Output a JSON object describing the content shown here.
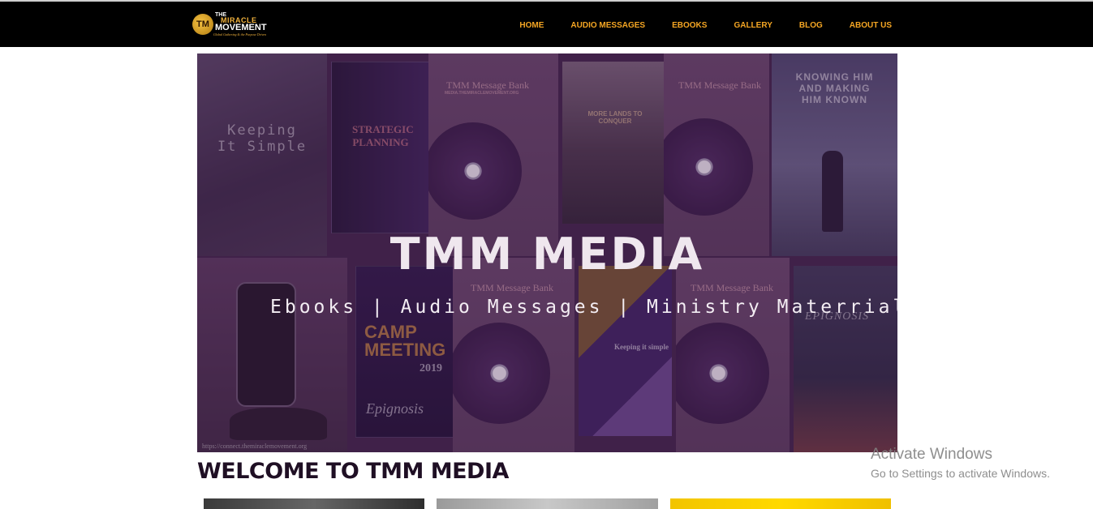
{
  "logo": {
    "mark": "TM",
    "line1": "THE",
    "line2": "MIRACLE",
    "line3": "MOVEMENT",
    "tagline": "Global Gathering & the Purpose Driven"
  },
  "nav": {
    "items": [
      {
        "label": "HOME"
      },
      {
        "label": "AUDIO MESSAGES"
      },
      {
        "label": "EBOOKS"
      },
      {
        "label": "GALLERY"
      },
      {
        "label": "BLOG"
      },
      {
        "label": "ABOUT US"
      }
    ]
  },
  "hero": {
    "title": "TMM MEDIA",
    "subtitle": "Ebooks | Audio Messages | Ministry Materrials",
    "url": "https://connect.themiraclemovement.org",
    "tiles": {
      "keeping": "Keeping It Simple",
      "strategic": "STRATEGIC PLANNING",
      "message_bank": "TMM Message Bank",
      "message_bank_url": "MEDIA.THEMIRACLEMOVEMENT.ORG",
      "more_lands": "MORE LANDS TO CONQUER",
      "knowing": "KNOWING HIM AND MAKING HIM KNOWN",
      "camp": "CAMP MEETING",
      "camp_year": "2019",
      "epignosis": "Epignosis",
      "keeping_simple": "Keeping it simple",
      "epignosis_book": "EPIGNOSIS"
    }
  },
  "welcome": {
    "heading": "WELCOME TO TMM MEDIA"
  },
  "os": {
    "activate_title": "Activate Windows",
    "activate_sub": "Go to Settings to activate Windows."
  }
}
